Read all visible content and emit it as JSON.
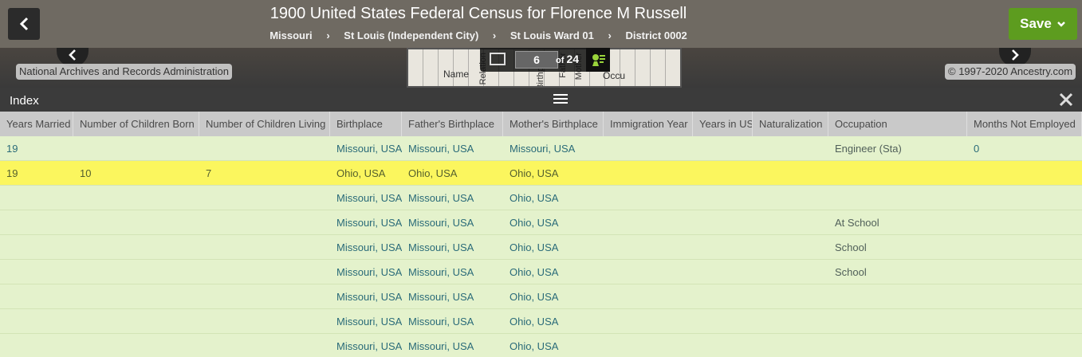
{
  "header": {
    "title": "1900 United States Federal Census for Florence M Russell",
    "breadcrumbs": [
      "Missouri",
      "St Louis (Independent City)",
      "St Louis Ward 01",
      "District 0002"
    ],
    "separator": "›",
    "save_label": "Save"
  },
  "viewer": {
    "source_label": "National Archives and Records Administration",
    "copyright": "© 1997-2020 Ancestry.com",
    "page_current": "6",
    "page_of_label": "of",
    "page_total": "24",
    "thumb_words": [
      "Name",
      "Relation",
      "Birthplace",
      "Father",
      "Mother",
      "Occu"
    ]
  },
  "index": {
    "label": "Index",
    "columns": [
      "Years Married",
      "Number of Children Born",
      "Number of Children Living",
      "Birthplace",
      "Father's Birthplace",
      "Mother's Birthplace",
      "Immigration Year",
      "Years in US",
      "Naturalization",
      "Occupation",
      "Months Not Employed"
    ],
    "rows": [
      [
        "19",
        "",
        "",
        "Missouri, USA",
        "Missouri, USA",
        "Missouri, USA",
        "",
        "",
        "",
        "Engineer (Sta)",
        "0"
      ],
      [
        "19",
        "10",
        "7",
        "Ohio, USA",
        "Ohio, USA",
        "Ohio, USA",
        "",
        "",
        "",
        "",
        ""
      ],
      [
        "",
        "",
        "",
        "Missouri, USA",
        "Missouri, USA",
        "Ohio, USA",
        "",
        "",
        "",
        "",
        ""
      ],
      [
        "",
        "",
        "",
        "Missouri, USA",
        "Missouri, USA",
        "Ohio, USA",
        "",
        "",
        "",
        "At School",
        ""
      ],
      [
        "",
        "",
        "",
        "Missouri, USA",
        "Missouri, USA",
        "Ohio, USA",
        "",
        "",
        "",
        "School",
        ""
      ],
      [
        "",
        "",
        "",
        "Missouri, USA",
        "Missouri, USA",
        "Ohio, USA",
        "",
        "",
        "",
        "School",
        ""
      ],
      [
        "",
        "",
        "",
        "Missouri, USA",
        "Missouri, USA",
        "Ohio, USA",
        "",
        "",
        "",
        "",
        ""
      ],
      [
        "",
        "",
        "",
        "Missouri, USA",
        "Missouri, USA",
        "Ohio, USA",
        "",
        "",
        "",
        "",
        ""
      ],
      [
        "",
        "",
        "",
        "Missouri, USA",
        "Missouri, USA",
        "Ohio, USA",
        "",
        "",
        "",
        "",
        ""
      ]
    ],
    "highlighted_row": 1
  },
  "icons": {
    "back": "chevron-left-icon",
    "save_caret": "chevron-down-icon",
    "prev": "chevron-left-icon",
    "next": "chevron-right-icon",
    "filmstrip": "filmstrip-icon",
    "tree": "tree-icon",
    "menu": "hamburger-icon",
    "close": "close-icon"
  },
  "colors": {
    "save": "#5d9c1f",
    "highlight": "#fbf65e",
    "row": "#e4f2cc",
    "header_bg": "#6f6a62"
  }
}
